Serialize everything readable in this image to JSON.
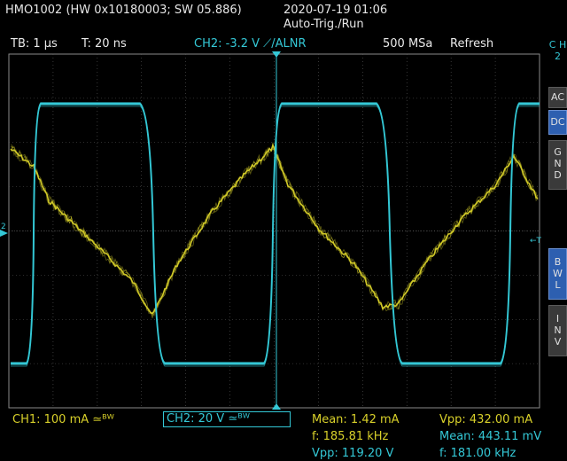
{
  "header": {
    "device": "HMO1002 (HW 0x10180003; SW 05.886)",
    "datetime": "2020-07-19 01:06",
    "trigger_mode": "Auto-Trig./Run"
  },
  "info_bar": {
    "timebase": "TB: 1 µs",
    "trigger_time": "T: 20 ns",
    "trigger_setting": "CH2: -3.2 V ⟋/ALNR",
    "sample_rate": "500 MSa",
    "mode": "Refresh"
  },
  "side_panel": {
    "channel_tab": [
      "C",
      "H",
      "2"
    ],
    "coupling_ac": "AC",
    "coupling_dc": "DC",
    "gnd": [
      "G",
      "N",
      "D"
    ],
    "bwl": [
      "B",
      "W",
      "L"
    ],
    "inv": [
      "I",
      "N",
      "V"
    ]
  },
  "markers": {
    "ch_marker": "2",
    "trigger_marker": "←T"
  },
  "bottom": {
    "ch1_scale": "CH1: 100 mA ≃ᴮᵂ",
    "ch2_scale": "CH2: 20 V ≃ᴮᵂ",
    "m1_label": "Mean: 1.42 mA",
    "m2_label": "f: 185.81 kHz",
    "m3_label": "Vpp: 119.20 V",
    "m4_label": "Vpp: 432.00 mA",
    "m5_label": "Mean: 443.11 mV",
    "m6_label": "f: 181.00 kHz"
  },
  "colors": {
    "ch1": "#d8d02a",
    "ch2": "#34c8d6",
    "grid": "#5a5a5a",
    "active_button": "#2d5fb0"
  }
}
